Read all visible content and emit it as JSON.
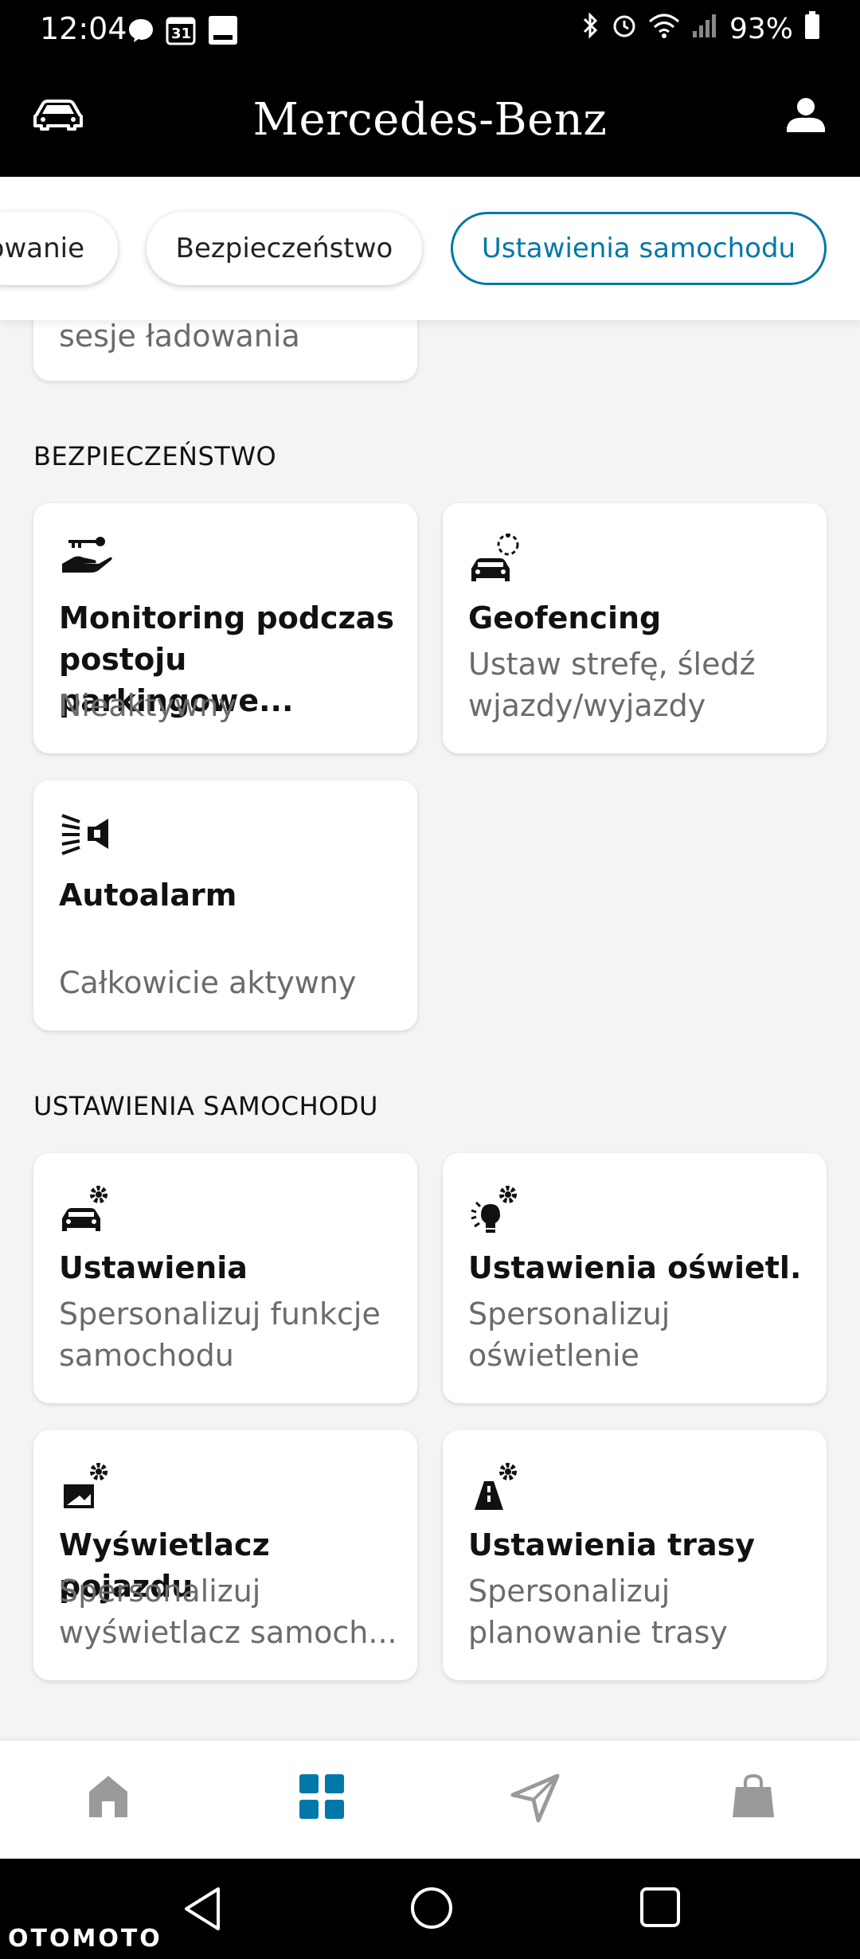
{
  "status_bar": {
    "time": "12:04",
    "battery": "93%",
    "calendar_day": "31"
  },
  "header": {
    "title": "Mercedes-Benz",
    "car_icon": "car-icon",
    "profile_icon": "profile-icon"
  },
  "chips": [
    {
      "label": "owanie",
      "active": false
    },
    {
      "label": "Bezpieczeństwo",
      "active": false
    },
    {
      "label": "Ustawienia samochodu",
      "active": true
    }
  ],
  "partial_card": {
    "subtitle": "sesje ładowania"
  },
  "sections": {
    "security": {
      "title": "BEZPIECZEŃSTWO",
      "cards": [
        {
          "icon": "key-hand-icon",
          "title": "Monitoring podczas postoju parkingowe...",
          "subtitle": "Nieaktywny"
        },
        {
          "icon": "geofence-car-icon",
          "title": "Geofencing",
          "subtitle": "Ustaw strefę, śledź wjazdy/wyjazdy"
        },
        {
          "icon": "alarm-horn-icon",
          "title": "Autoalarm",
          "subtitle": "Całkowicie aktywny"
        }
      ]
    },
    "car_settings": {
      "title": "USTAWIENIA SAMOCHODU",
      "cards": [
        {
          "icon": "car-gear-icon",
          "title": "Ustawienia",
          "subtitle": "Spersonalizuj funkcje samochodu"
        },
        {
          "icon": "light-gear-icon",
          "title": "Ustawienia oświetl.",
          "subtitle": "Spersonalizuj oświetlenie"
        },
        {
          "icon": "display-gear-icon",
          "title": "Wyświetlacz pojazdu",
          "subtitle": "Spersonalizuj wyświetlacz samoch..."
        },
        {
          "icon": "route-gear-icon",
          "title": "Ustawienia trasy",
          "subtitle": "Spersonalizuj planowanie trasy"
        }
      ]
    }
  },
  "bottom_nav": [
    {
      "icon": "home-icon",
      "active": false
    },
    {
      "icon": "grid-icon",
      "active": true
    },
    {
      "icon": "navigation-icon",
      "active": false
    },
    {
      "icon": "shopping-bag-icon",
      "active": false
    }
  ],
  "colors": {
    "accent": "#0078a8",
    "header_bg": "#000000",
    "page_bg": "#f4f4f4",
    "inactive_nav": "#9a9a9a"
  },
  "watermark": "OTOMOTO"
}
